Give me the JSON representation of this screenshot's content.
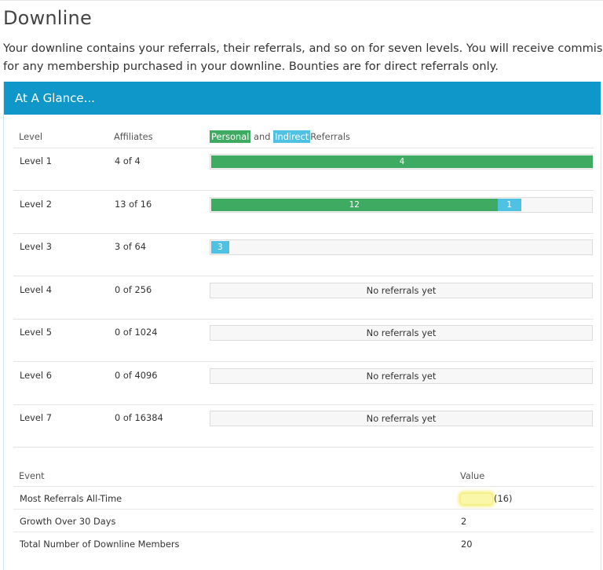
{
  "page": {
    "title": "Downline",
    "intro": "Your downline contains your referrals, their referrals, and so on for seven levels. You will receive commission for any membership purchased in your downline. Bounties are for direct referrals only.",
    "intro_line1": "Your downline contains your referrals, their referrals, and so on for seven levels. You will receive commission",
    "intro_line2": "for any membership purchased in your downline. Bounties are for direct referrals only."
  },
  "panel": {
    "title": "At A Glance...",
    "columns": {
      "level": "Level",
      "affiliates": "Affiliates",
      "personal_chip": "Personal",
      "and": "and",
      "indirect_chip": "Indirect",
      "referrals": "Referrals"
    },
    "colors": {
      "header": "#0e97c8",
      "personal": "#3fab62",
      "indirect": "#4fc1e2"
    },
    "levels": [
      {
        "name": "Level 1",
        "affiliates": "4 of 4",
        "personal": 4,
        "indirect": 0,
        "capacity": 4,
        "empty_text": ""
      },
      {
        "name": "Level 2",
        "affiliates": "13 of 16",
        "personal": 12,
        "indirect": 1,
        "capacity": 16,
        "empty_text": ""
      },
      {
        "name": "Level 3",
        "affiliates": "3 of 64",
        "personal": 0,
        "indirect": 3,
        "capacity": 64,
        "empty_text": ""
      },
      {
        "name": "Level 4",
        "affiliates": "0 of 256",
        "personal": 0,
        "indirect": 0,
        "capacity": 256,
        "empty_text": "No referrals yet"
      },
      {
        "name": "Level 5",
        "affiliates": "0 of 1024",
        "personal": 0,
        "indirect": 0,
        "capacity": 1024,
        "empty_text": "No referrals yet"
      },
      {
        "name": "Level 6",
        "affiliates": "0 of 4096",
        "personal": 0,
        "indirect": 0,
        "capacity": 4096,
        "empty_text": "No referrals yet"
      },
      {
        "name": "Level 7",
        "affiliates": "0 of 16384",
        "personal": 0,
        "indirect": 0,
        "capacity": 16384,
        "empty_text": "No referrals yet"
      }
    ],
    "events": {
      "event_header": "Event",
      "value_header": "Value",
      "rows": [
        {
          "label": "Most Referrals All-Time",
          "value": "(16)",
          "redacted": true
        },
        {
          "label": "Growth Over 30 Days",
          "value": "2",
          "redacted": false
        },
        {
          "label": "Total Number of Downline Members",
          "value": "20",
          "redacted": false
        }
      ]
    }
  }
}
